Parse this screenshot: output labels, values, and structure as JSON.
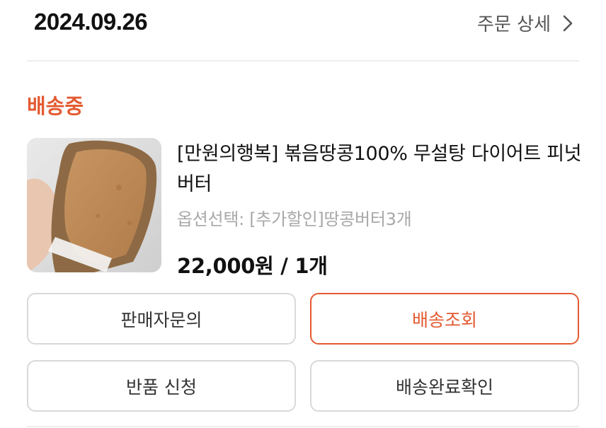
{
  "header": {
    "order_date": "2024.09.26",
    "detail_label": "주문 상세",
    "detail_icon": "chevron-right-icon"
  },
  "order": {
    "status": "배송중",
    "status_color": "#e35a30",
    "product": {
      "name": "[만원의행복] 볶음땅콩100% 무설탕 다이어트 피넛버터",
      "option": "옵션선택: [추가할인]땅콩버터3개",
      "price": "22,000원 / 1개",
      "image": "peanut-butter-toast-photo"
    }
  },
  "actions": {
    "seller_inquiry": "판매자문의",
    "track_delivery": "배송조회",
    "return_request": "반품 신청",
    "confirm_delivery": "배송완료확인"
  },
  "colors": {
    "accent": "#e35a30",
    "border": "#d9d9d9",
    "muted_text": "#a8a8a8"
  }
}
